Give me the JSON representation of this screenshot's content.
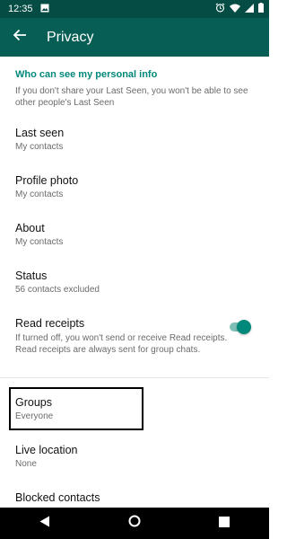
{
  "status_bar": {
    "time": "12:35"
  },
  "app_bar": {
    "title": "Privacy"
  },
  "section": {
    "header": "Who can see my personal info",
    "note": "If you don't share your Last Seen, you won't be able to see other people's Last Seen"
  },
  "settings": [
    {
      "title": "Last seen",
      "value": "My contacts"
    },
    {
      "title": "Profile photo",
      "value": "My contacts"
    },
    {
      "title": "About",
      "value": "My contacts"
    },
    {
      "title": "Status",
      "value": "56 contacts excluded"
    }
  ],
  "read_receipts": {
    "title": "Read receipts",
    "description": "If turned off, you won't send or receive Read receipts. Read receipts are always sent for group chats.",
    "enabled": true
  },
  "groups": {
    "title": "Groups",
    "value": "Everyone"
  },
  "live_location": {
    "title": "Live location",
    "value": "None"
  },
  "blocked_contacts": {
    "title": "Blocked contacts"
  },
  "colors": {
    "app_bar": "#075e54",
    "status_bar": "#054d44",
    "accent": "#00897b"
  }
}
